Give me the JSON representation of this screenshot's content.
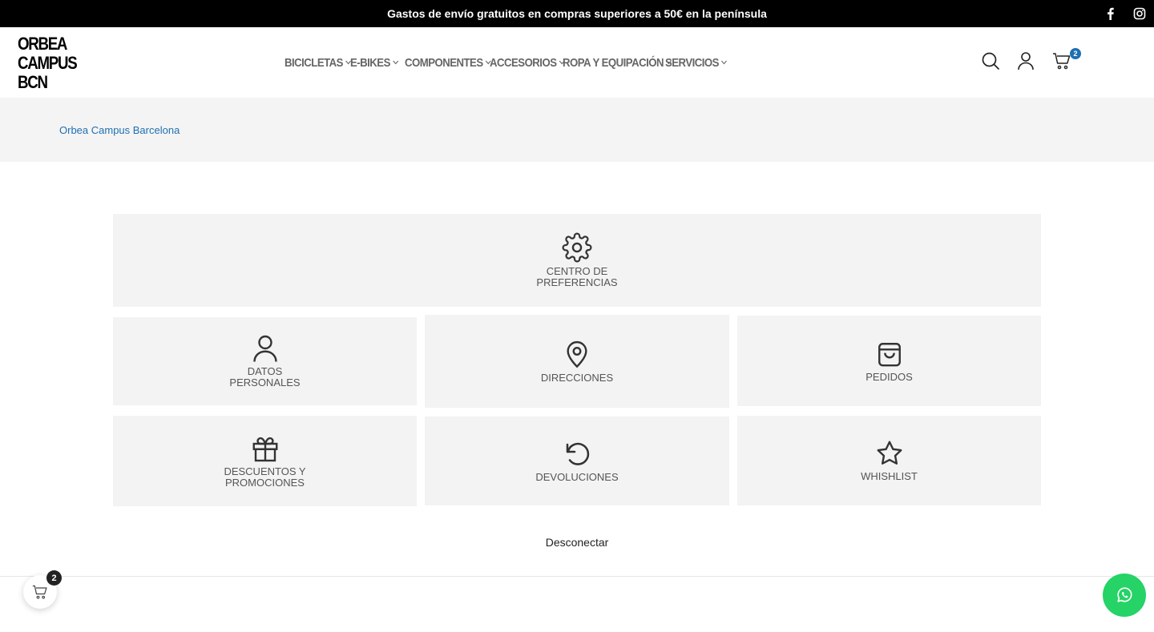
{
  "topbar": {
    "message": "Gastos de envío gratuitos en compras superiores a 50€ en la península",
    "facebook_icon": "facebook-icon",
    "instagram_icon": "instagram-icon"
  },
  "header": {
    "logo_lines": [
      "ORBEA",
      "CAMPUS",
      "BCN"
    ],
    "nav": [
      {
        "label": "BICICLETAS"
      },
      {
        "label": "E-BIKES"
      },
      {
        "label": "COMPONENTES"
      },
      {
        "label": "ACCESORIOS"
      },
      {
        "label": "ROPA Y EQUIPACIÓN"
      },
      {
        "label": "SERVICIOS"
      }
    ],
    "cart_count": "2"
  },
  "breadcrumb": {
    "label": "Orbea Campus Barcelona"
  },
  "tiles": {
    "preferences": {
      "label": "CENTRO DE\nPREFERENCIAS",
      "icon": "gear-icon"
    },
    "personal": {
      "label": "DATOS\nPERSONALES",
      "icon": "user-icon"
    },
    "addresses": {
      "label": "DIRECCIONES",
      "icon": "map-pin-icon"
    },
    "orders": {
      "label": "PEDIDOS",
      "icon": "shopping-bag-icon"
    },
    "discounts": {
      "label": "DESCUENTOS Y\nPROMOCIONES",
      "icon": "gift-icon"
    },
    "returns": {
      "label": "DEVOLUCIONES",
      "icon": "undo-icon"
    },
    "wishlist": {
      "label": "WHISHLIST",
      "icon": "star-icon"
    }
  },
  "logout": {
    "label": "Desconectar"
  },
  "floating": {
    "cart_count": "2"
  },
  "colors": {
    "accent": "#1f6fb2",
    "tile_bg": "#f3f3f3",
    "whatsapp": "#25d366"
  }
}
